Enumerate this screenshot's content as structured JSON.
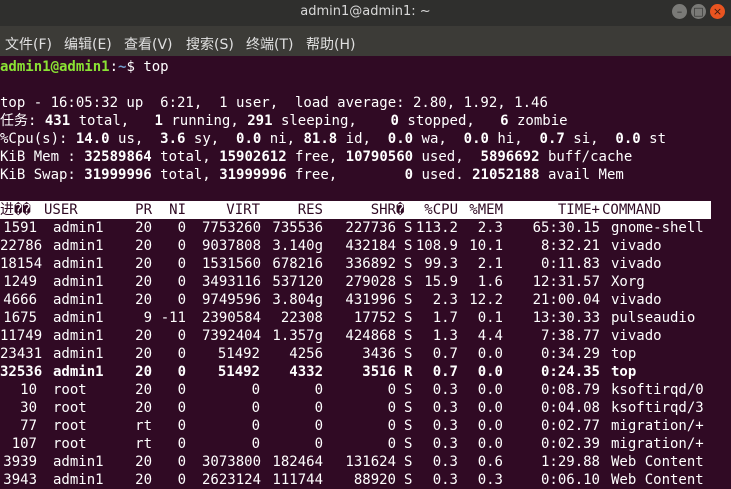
{
  "window": {
    "title": "admin1@admin1: ~"
  },
  "menu": [
    "文件(F)",
    "编辑(E)",
    "查看(V)",
    "搜索(S)",
    "终端(T)",
    "帮助(H)"
  ],
  "prompt": {
    "user": "admin1@admin1",
    "colon": ":",
    "path": "~",
    "dollar": "$",
    "command": "top"
  },
  "summary": {
    "top": "top - 16:05:32 up  6:21,  1 user,  load average: 2.80, 1.92, 1.46",
    "tasks": {
      "label": "任务:",
      "total": "431",
      "total_l": " total,",
      "running": "1",
      "running_l": " running,",
      "sleeping": "291",
      "sleeping_l": " sleeping,",
      "stopped": "0",
      "stopped_l": " stopped,",
      "zombie": "6",
      "zombie_l": " zombie"
    },
    "cpu": {
      "label": "%Cpu(s):",
      "us": "14.0",
      "us_l": " us,",
      "sy": "3.6",
      "sy_l": " sy,",
      "ni": "0.0",
      "ni_l": " ni,",
      "id": "81.8",
      "id_l": " id,",
      "wa": "0.0",
      "wa_l": " wa,",
      "hi": "0.0",
      "hi_l": " hi,",
      "si": "0.7",
      "si_l": " si,",
      "st": "0.0",
      "st_l": " st"
    },
    "mem": {
      "label": "KiB Mem :",
      "total": "32589864",
      "total_l": " total,",
      "free": "15902612",
      "free_l": " free,",
      "used": "10790560",
      "used_l": " used,",
      "cache": "5896692",
      "cache_l": " buff/cache"
    },
    "swap": {
      "label": "KiB Swap:",
      "total": "31999996",
      "total_l": " total,",
      "free": "31999996",
      "free_l": " free,",
      "used": "0",
      "used_l": " used.",
      "avail": "21052188",
      "avail_l": " avail Mem"
    }
  },
  "columns": [
    "进�� ",
    "USER",
    "PR",
    "NI",
    "VIRT",
    "RES",
    "SHR",
    "�",
    "%CPU",
    "%MEM",
    "TIME+",
    "COMMAND"
  ],
  "processes": [
    [
      "1591",
      "admin1",
      "20",
      "0",
      "7753260",
      "735536",
      "227736",
      "S",
      "113.2",
      "2.3",
      "65:30.15",
      "gnome-shell"
    ],
    [
      "22786",
      "admin1",
      "20",
      "0",
      "9037808",
      "3.140g",
      "432184",
      "S",
      "108.9",
      "10.1",
      "8:32.21",
      "vivado"
    ],
    [
      "18154",
      "admin1",
      "20",
      "0",
      "1531560",
      "678216",
      "336892",
      "S",
      "99.3",
      "2.1",
      "0:11.83",
      "vivado"
    ],
    [
      "1249",
      "admin1",
      "20",
      "0",
      "3493116",
      "537120",
      "279028",
      "S",
      "15.9",
      "1.6",
      "12:31.57",
      "Xorg"
    ],
    [
      "4666",
      "admin1",
      "20",
      "0",
      "9749596",
      "3.804g",
      "431996",
      "S",
      "2.3",
      "12.2",
      "21:00.04",
      "vivado"
    ],
    [
      "1675",
      "admin1",
      "9",
      "-11",
      "2390584",
      "22308",
      "17752",
      "S",
      "1.7",
      "0.1",
      "13:30.33",
      "pulseaudio"
    ],
    [
      "11749",
      "admin1",
      "20",
      "0",
      "7392404",
      "1.357g",
      "424868",
      "S",
      "1.3",
      "4.4",
      "7:38.77",
      "vivado"
    ],
    [
      "23431",
      "admin1",
      "20",
      "0",
      "51492",
      "4256",
      "3436",
      "S",
      "0.7",
      "0.0",
      "0:34.29",
      "top"
    ],
    [
      "32536",
      "admin1",
      "20",
      "0",
      "51492",
      "4332",
      "3516",
      "R",
      "0.7",
      "0.0",
      "0:24.35",
      "top"
    ],
    [
      "10",
      "root",
      "20",
      "0",
      "0",
      "0",
      "0",
      "S",
      "0.3",
      "0.0",
      "0:08.79",
      "ksoftirqd/0"
    ],
    [
      "30",
      "root",
      "20",
      "0",
      "0",
      "0",
      "0",
      "S",
      "0.3",
      "0.0",
      "0:04.08",
      "ksoftirqd/3"
    ],
    [
      "77",
      "root",
      "rt",
      "0",
      "0",
      "0",
      "0",
      "S",
      "0.3",
      "0.0",
      "0:02.77",
      "migration/+"
    ],
    [
      "107",
      "root",
      "rt",
      "0",
      "0",
      "0",
      "0",
      "S",
      "0.3",
      "0.0",
      "0:02.39",
      "migration/+"
    ],
    [
      "3939",
      "admin1",
      "20",
      "0",
      "3073800",
      "182464",
      "131624",
      "S",
      "0.3",
      "0.6",
      "1:29.88",
      "Web Content"
    ],
    [
      "3943",
      "admin1",
      "20",
      "0",
      "2623124",
      "111744",
      "88920",
      "S",
      "0.3",
      "0.3",
      "0:06.10",
      "Web Content"
    ]
  ],
  "highlight_row": 8,
  "colors": {
    "background": "#300a24",
    "prompt_user": "#8ae234",
    "prompt_path": "#729fcf",
    "close_button": "#e95420"
  }
}
